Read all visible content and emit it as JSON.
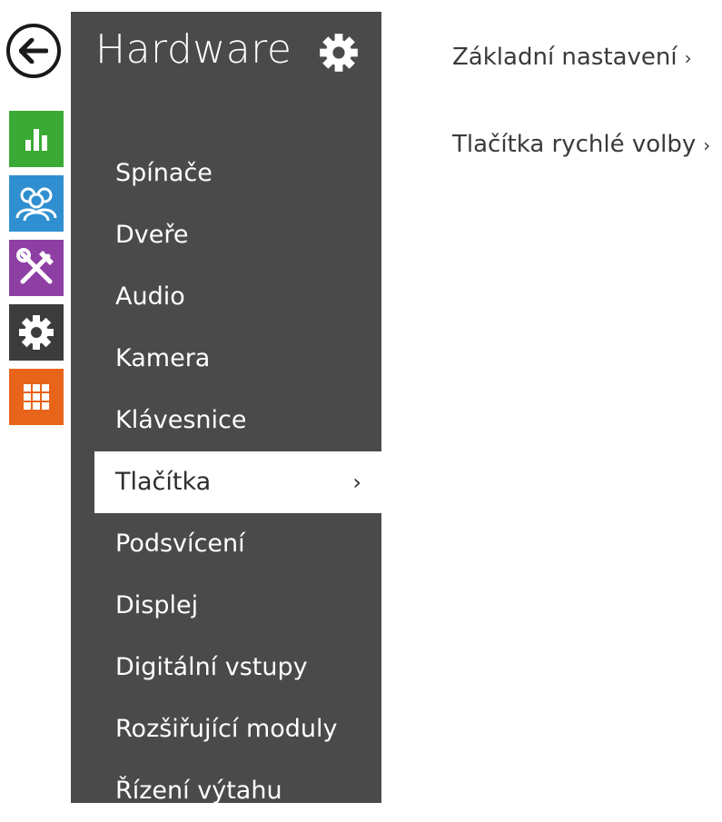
{
  "rail": {
    "items": [
      {
        "name": "status-icon",
        "color": "#3aaa35"
      },
      {
        "name": "users-icon",
        "color": "#2f8fd0"
      },
      {
        "name": "tools-icon",
        "color": "#8e3fa3"
      },
      {
        "name": "gear-icon",
        "color": "#3c3c3c"
      },
      {
        "name": "grid-icon",
        "color": "#e8641a"
      }
    ]
  },
  "panel": {
    "title": "Hardware",
    "background": "#4a4a4a",
    "items": [
      {
        "label": "Spínače"
      },
      {
        "label": "Dveře"
      },
      {
        "label": "Audio"
      },
      {
        "label": "Kamera"
      },
      {
        "label": "Klávesnice"
      },
      {
        "label": "Tlačítka",
        "active": true,
        "chevron": "›"
      },
      {
        "label": "Podsvícení"
      },
      {
        "label": "Displej"
      },
      {
        "label": "Digitální vstupy"
      },
      {
        "label": "Rozšiřující moduly"
      },
      {
        "label": "Řízení výtahu"
      }
    ]
  },
  "content": {
    "links": [
      {
        "label": "Základní nastavení",
        "chevron": "›"
      },
      {
        "label": "Tlačítka rychlé volby",
        "chevron": "›"
      }
    ]
  }
}
